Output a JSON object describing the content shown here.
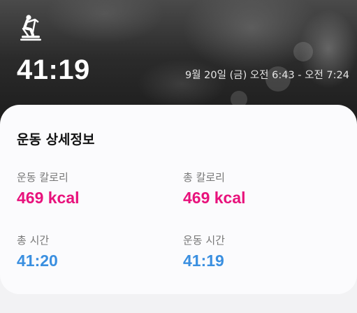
{
  "header": {
    "activity_icon": "stationary-bike-icon",
    "duration": "41:19",
    "date_range": "9월 20일 (금) 오전 6:43 - 오전 7:24"
  },
  "details": {
    "title": "운동 상세정보",
    "stats": [
      {
        "label": "운동 칼로리",
        "value": "469 kcal",
        "color": "#e8127c"
      },
      {
        "label": "총 칼로리",
        "value": "469 kcal",
        "color": "#e8127c"
      },
      {
        "label": "총 시간",
        "value": "41:20",
        "color": "#3a8fe0"
      },
      {
        "label": "운동 시간",
        "value": "41:19",
        "color": "#3a8fe0"
      }
    ]
  }
}
